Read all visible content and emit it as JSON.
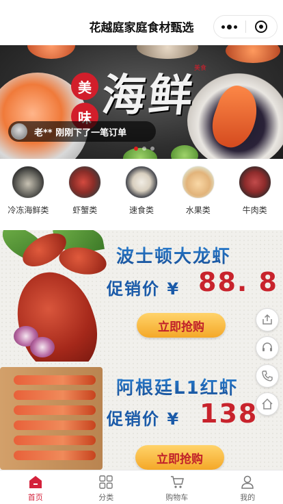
{
  "header": {
    "title": "花越庭家庭食材甄选",
    "more_icon": "more-dots-icon",
    "close_icon": "target-close-icon"
  },
  "banner": {
    "seal_chars": [
      "美",
      "味"
    ],
    "calligraphy": "海鲜",
    "small_mark": "美食",
    "order_notice": "老** 刚刚下了一笔订单",
    "indicator_count": 3,
    "active_indicator": 0
  },
  "categories": [
    {
      "label": "冷冻海鲜类",
      "icon": "frozen-seafood-image"
    },
    {
      "label": "虾蟹类",
      "icon": "shrimp-crab-image"
    },
    {
      "label": "速食类",
      "icon": "fast-food-image"
    },
    {
      "label": "水果类",
      "icon": "fruit-image"
    },
    {
      "label": "牛肉类",
      "icon": "beef-image"
    }
  ],
  "promos": [
    {
      "name": "波士顿大龙虾",
      "price_label": "促销价 ¥",
      "price": "88. 8",
      "button": "立即抢购"
    },
    {
      "name": "阿根廷L1红虾",
      "price_label": "促销价 ¥",
      "price": "138",
      "button": "立即抢购"
    }
  ],
  "floating_actions": [
    "share-icon",
    "customer-service-icon",
    "phone-icon",
    "home-icon"
  ],
  "tabbar": [
    {
      "label": "首页",
      "icon": "home-icon",
      "active": true
    },
    {
      "label": "分类",
      "icon": "category-grid-icon",
      "active": false
    },
    {
      "label": "购物车",
      "icon": "cart-icon",
      "active": false
    },
    {
      "label": "我的",
      "icon": "user-icon",
      "active": false
    }
  ],
  "colors": {
    "accent": "#d4213b",
    "promo_blue": "#1a6fc4",
    "price_red": "#c8232c",
    "button_gold": "#f4a828"
  }
}
